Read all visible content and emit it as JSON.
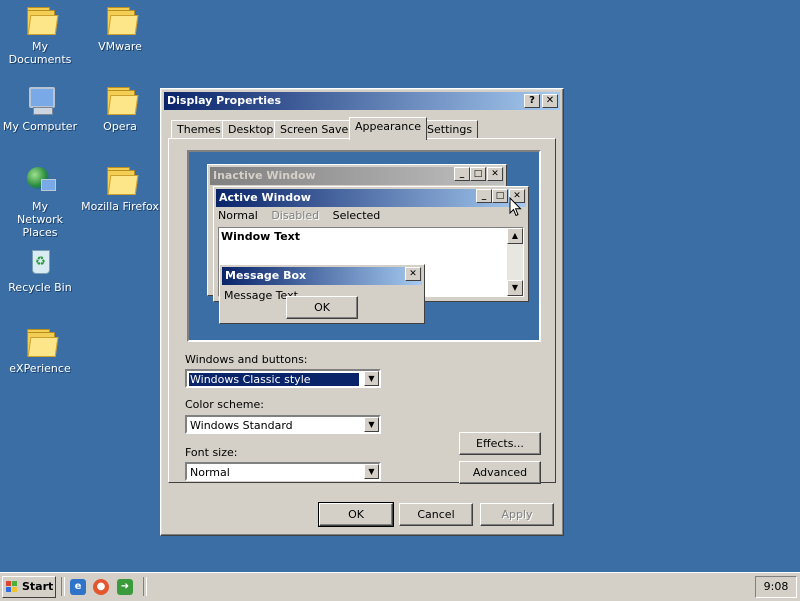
{
  "desktop": {
    "icons": [
      {
        "label": "My Documents"
      },
      {
        "label": "VMware"
      },
      {
        "label": "My Computer"
      },
      {
        "label": "Opera"
      },
      {
        "label": "My Network Places"
      },
      {
        "label": "Mozilla Firefox"
      },
      {
        "label": "Recycle Bin"
      },
      {
        "label": "eXPerience"
      }
    ]
  },
  "dialog": {
    "title": "Display Properties",
    "help_glyph": "?",
    "close_glyph": "✕",
    "tabs": [
      "Themes",
      "Desktop",
      "Screen Saver",
      "Appearance",
      "Settings"
    ],
    "active_tab": "Appearance",
    "preview": {
      "inactive_title": "Inactive Window",
      "active_title": "Active Window",
      "menu": {
        "normal": "Normal",
        "disabled": "Disabled",
        "selected": "Selected"
      },
      "window_text": "Window Text",
      "message_box_title": "Message Box",
      "message_text": "Message Text",
      "ok": "OK"
    },
    "windows_buttons": {
      "label": "Windows and buttons:",
      "value": "Windows Classic style"
    },
    "color_scheme": {
      "label": "Color scheme:",
      "value": "Windows Standard"
    },
    "font_size": {
      "label": "Font size:",
      "value": "Normal"
    },
    "effects_button": "Effects...",
    "advanced_button": "Advanced",
    "ok_button": "OK",
    "cancel_button": "Cancel",
    "apply_button": "Apply"
  },
  "taskbar": {
    "start_label": "Start",
    "clock": "9:08"
  },
  "colors": {
    "desktop": "#3a6ea5",
    "title_active_start": "#0a246a",
    "title_active_end": "#a6caf0",
    "face": "#d4d0c8"
  }
}
